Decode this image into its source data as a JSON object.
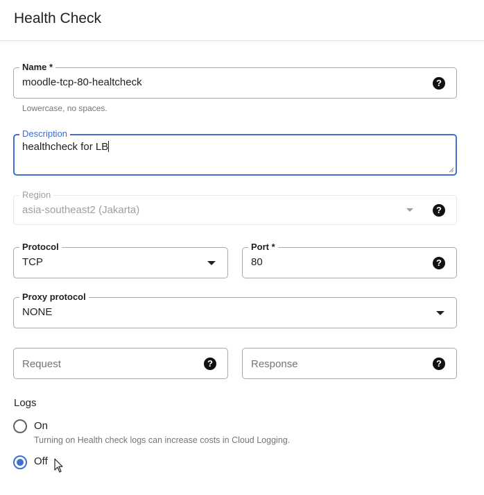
{
  "header": {
    "title": "Health Check"
  },
  "form": {
    "name": {
      "label": "Name *",
      "value": "moodle-tcp-80-healtcheck",
      "hint": "Lowercase, no spaces.",
      "help_icon": "help-circle-icon"
    },
    "description": {
      "label": "Description",
      "value": "healthcheck for LB"
    },
    "region": {
      "label": "Region",
      "value": "asia-southeast2 (Jakarta)",
      "disabled": true,
      "help_icon": "help-circle-icon"
    },
    "protocol": {
      "label": "Protocol",
      "value": "TCP"
    },
    "port": {
      "label": "Port *",
      "value": "80",
      "help_icon": "help-circle-icon"
    },
    "proxy_protocol": {
      "label": "Proxy protocol",
      "value": "NONE"
    },
    "request": {
      "placeholder": "Request",
      "value": "",
      "help_icon": "help-circle-icon"
    },
    "response": {
      "placeholder": "Response",
      "value": "",
      "help_icon": "help-circle-icon"
    },
    "logs": {
      "label": "Logs",
      "options": [
        {
          "label": "On",
          "description": "Turning on Health check logs can increase costs in Cloud Logging.",
          "checked": false
        },
        {
          "label": "Off",
          "checked": true
        }
      ]
    }
  },
  "colors": {
    "accent": "#3c6fd1",
    "border": "#a8a8a8",
    "hint": "#757575"
  }
}
